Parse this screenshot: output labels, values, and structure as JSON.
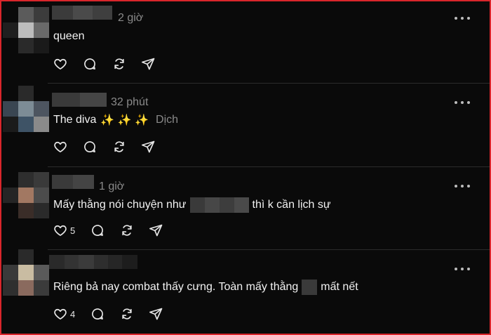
{
  "comments": [
    {
      "time": "2 giờ",
      "text": "queen",
      "like_count": "",
      "has_translate": false
    },
    {
      "time": "32 phút",
      "text": "The diva",
      "sparkles": "✨ ✨ ✨",
      "translate_label": "Dịch",
      "like_count": "",
      "has_translate": true
    },
    {
      "time": "1 giờ",
      "text_before": "Mấy thằng nói chuyện như",
      "text_after": "thì k cần lịch sự",
      "like_count": "5",
      "has_translate": false
    },
    {
      "time": "",
      "text_before": "Riêng bả nay combat thấy cưng. Toàn mấy thằng",
      "text_after": "mất nết",
      "like_count": "4",
      "has_translate": false
    }
  ],
  "icons": {
    "like": "heart-icon",
    "reply": "comment-bubble-icon",
    "repost": "repost-icon",
    "share": "send-icon",
    "more": "more-dots-icon"
  },
  "colors": {
    "background": "#0a0a0a",
    "frame_border": "#d9262b",
    "text": "#f2f2f2",
    "muted": "#8a8a8a",
    "divider": "#2b2b2b"
  }
}
